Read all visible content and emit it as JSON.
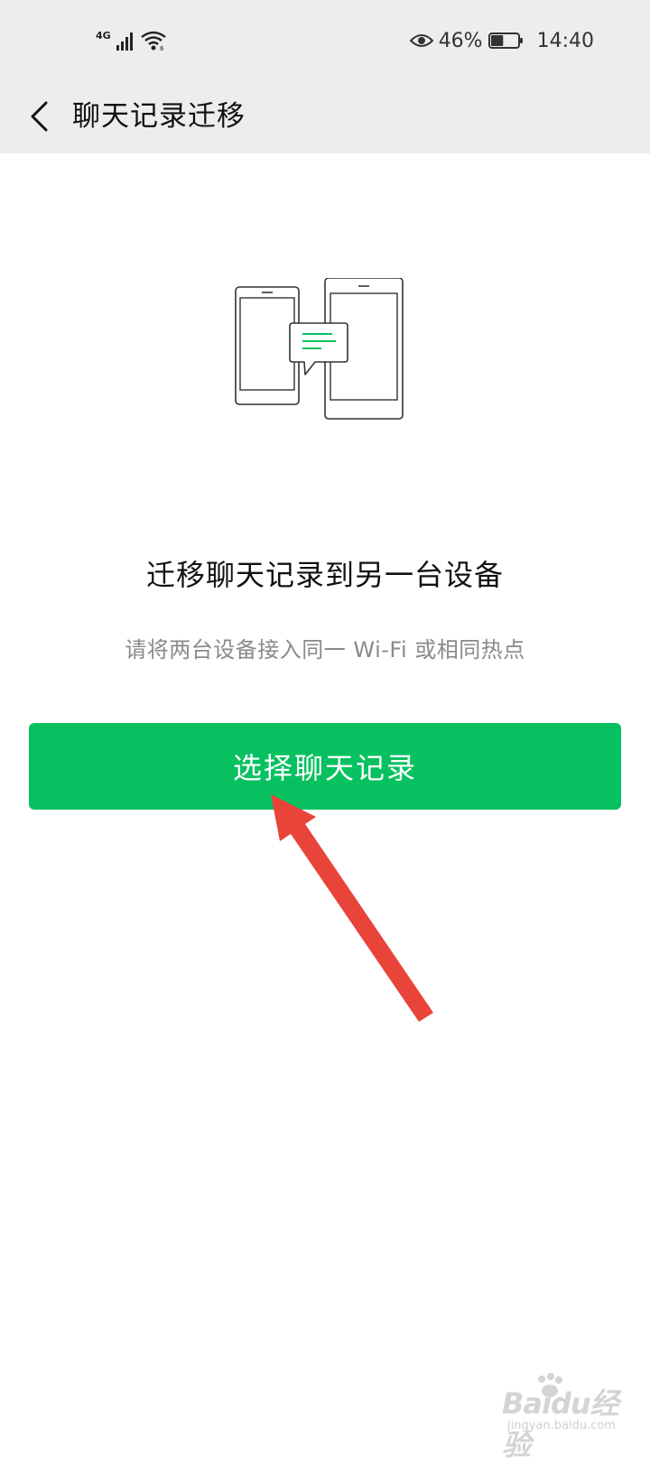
{
  "status_bar": {
    "network_type": "4G",
    "eye_comfort_icon": "eye-icon",
    "battery_percent": "46%",
    "battery_level": 0.46,
    "time": "14:40"
  },
  "nav": {
    "back_icon": "chevron-left-icon",
    "title": "聊天记录迁移"
  },
  "illustration": {
    "icon": "two-phones-chat-icon",
    "accent_color": "#07c160"
  },
  "content": {
    "headline": "迁移聊天记录到另一台设备",
    "subtext": "请将两台设备接入同一 Wi-Fi 或相同热点"
  },
  "action": {
    "select_label": "选择聊天记录",
    "button_color": "#07c160"
  },
  "annotation": {
    "arrow_icon": "red-arrow-icon",
    "color": "#e8443a"
  },
  "watermark": {
    "brand": "Baidu经验",
    "domain": "jingyan.baidu.com"
  }
}
